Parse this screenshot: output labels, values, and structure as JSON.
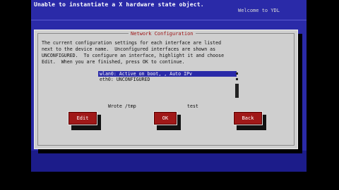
{
  "top_message": "Unable to instantiate a X hardware state object.",
  "welcome": "Welcome to YDL",
  "dialog": {
    "title": "Network Configuration",
    "description": "The current configuration settings for each interface are listed\nnext to the device name.  Unconfigured interfaces are shown as\nUNCONFIGURED.  To configure an interface, highlight it and choose\nEdit.  When you are finished, press OK to continue.",
    "interfaces": [
      "wlan0: Active on boot, , Auto IPv",
      "eth0: UNCONFIGURED"
    ],
    "text_left": "Wrote /tmp",
    "text_right": "test",
    "buttons": {
      "edit": "Edit",
      "ok": "OK",
      "back": "Back"
    }
  },
  "colors": {
    "background": "#2a2aa8",
    "dialog": "#cfcfcf",
    "button": "#a01818",
    "selection": "#2a2aa8"
  }
}
